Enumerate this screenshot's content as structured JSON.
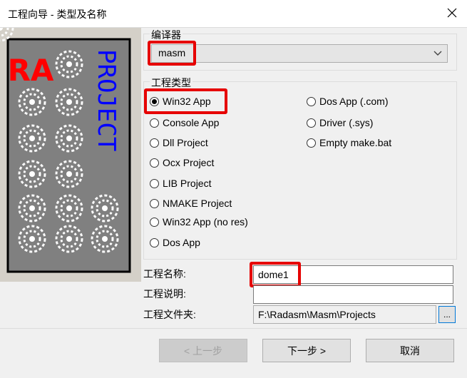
{
  "window": {
    "title": "工程向导 - 类型及名称"
  },
  "compiler": {
    "group_label": "编译器",
    "selected": "masm"
  },
  "project_type": {
    "group_label": "工程类型",
    "left_options": [
      "Win32 App",
      "Console App",
      "Dll Project",
      "Ocx Project",
      "LIB Project",
      "NMAKE Project",
      "Win32 App (no res)",
      "Dos App"
    ],
    "right_options": [
      "Dos App (.com)",
      "Driver (.sys)",
      "Empty make.bat"
    ],
    "selected": "Win32 App"
  },
  "fields": {
    "name_label": "工程名称:",
    "name_value": "dome1",
    "desc_label": "工程说明:",
    "desc_value": "",
    "folder_label": "工程文件夹:",
    "folder_value": "F:\\Radasm\\Masm\\Projects",
    "browse_label": "..."
  },
  "buttons": {
    "back": "< 上一步",
    "next": "下一步 >",
    "cancel": "取消"
  },
  "banner": {
    "text": "PROJECT",
    "logo": "RA"
  },
  "colors": {
    "highlight": "#e60000",
    "banner_blue": "#0000ff",
    "banner_red": "#ff0000",
    "banner_gray": "#808080"
  }
}
